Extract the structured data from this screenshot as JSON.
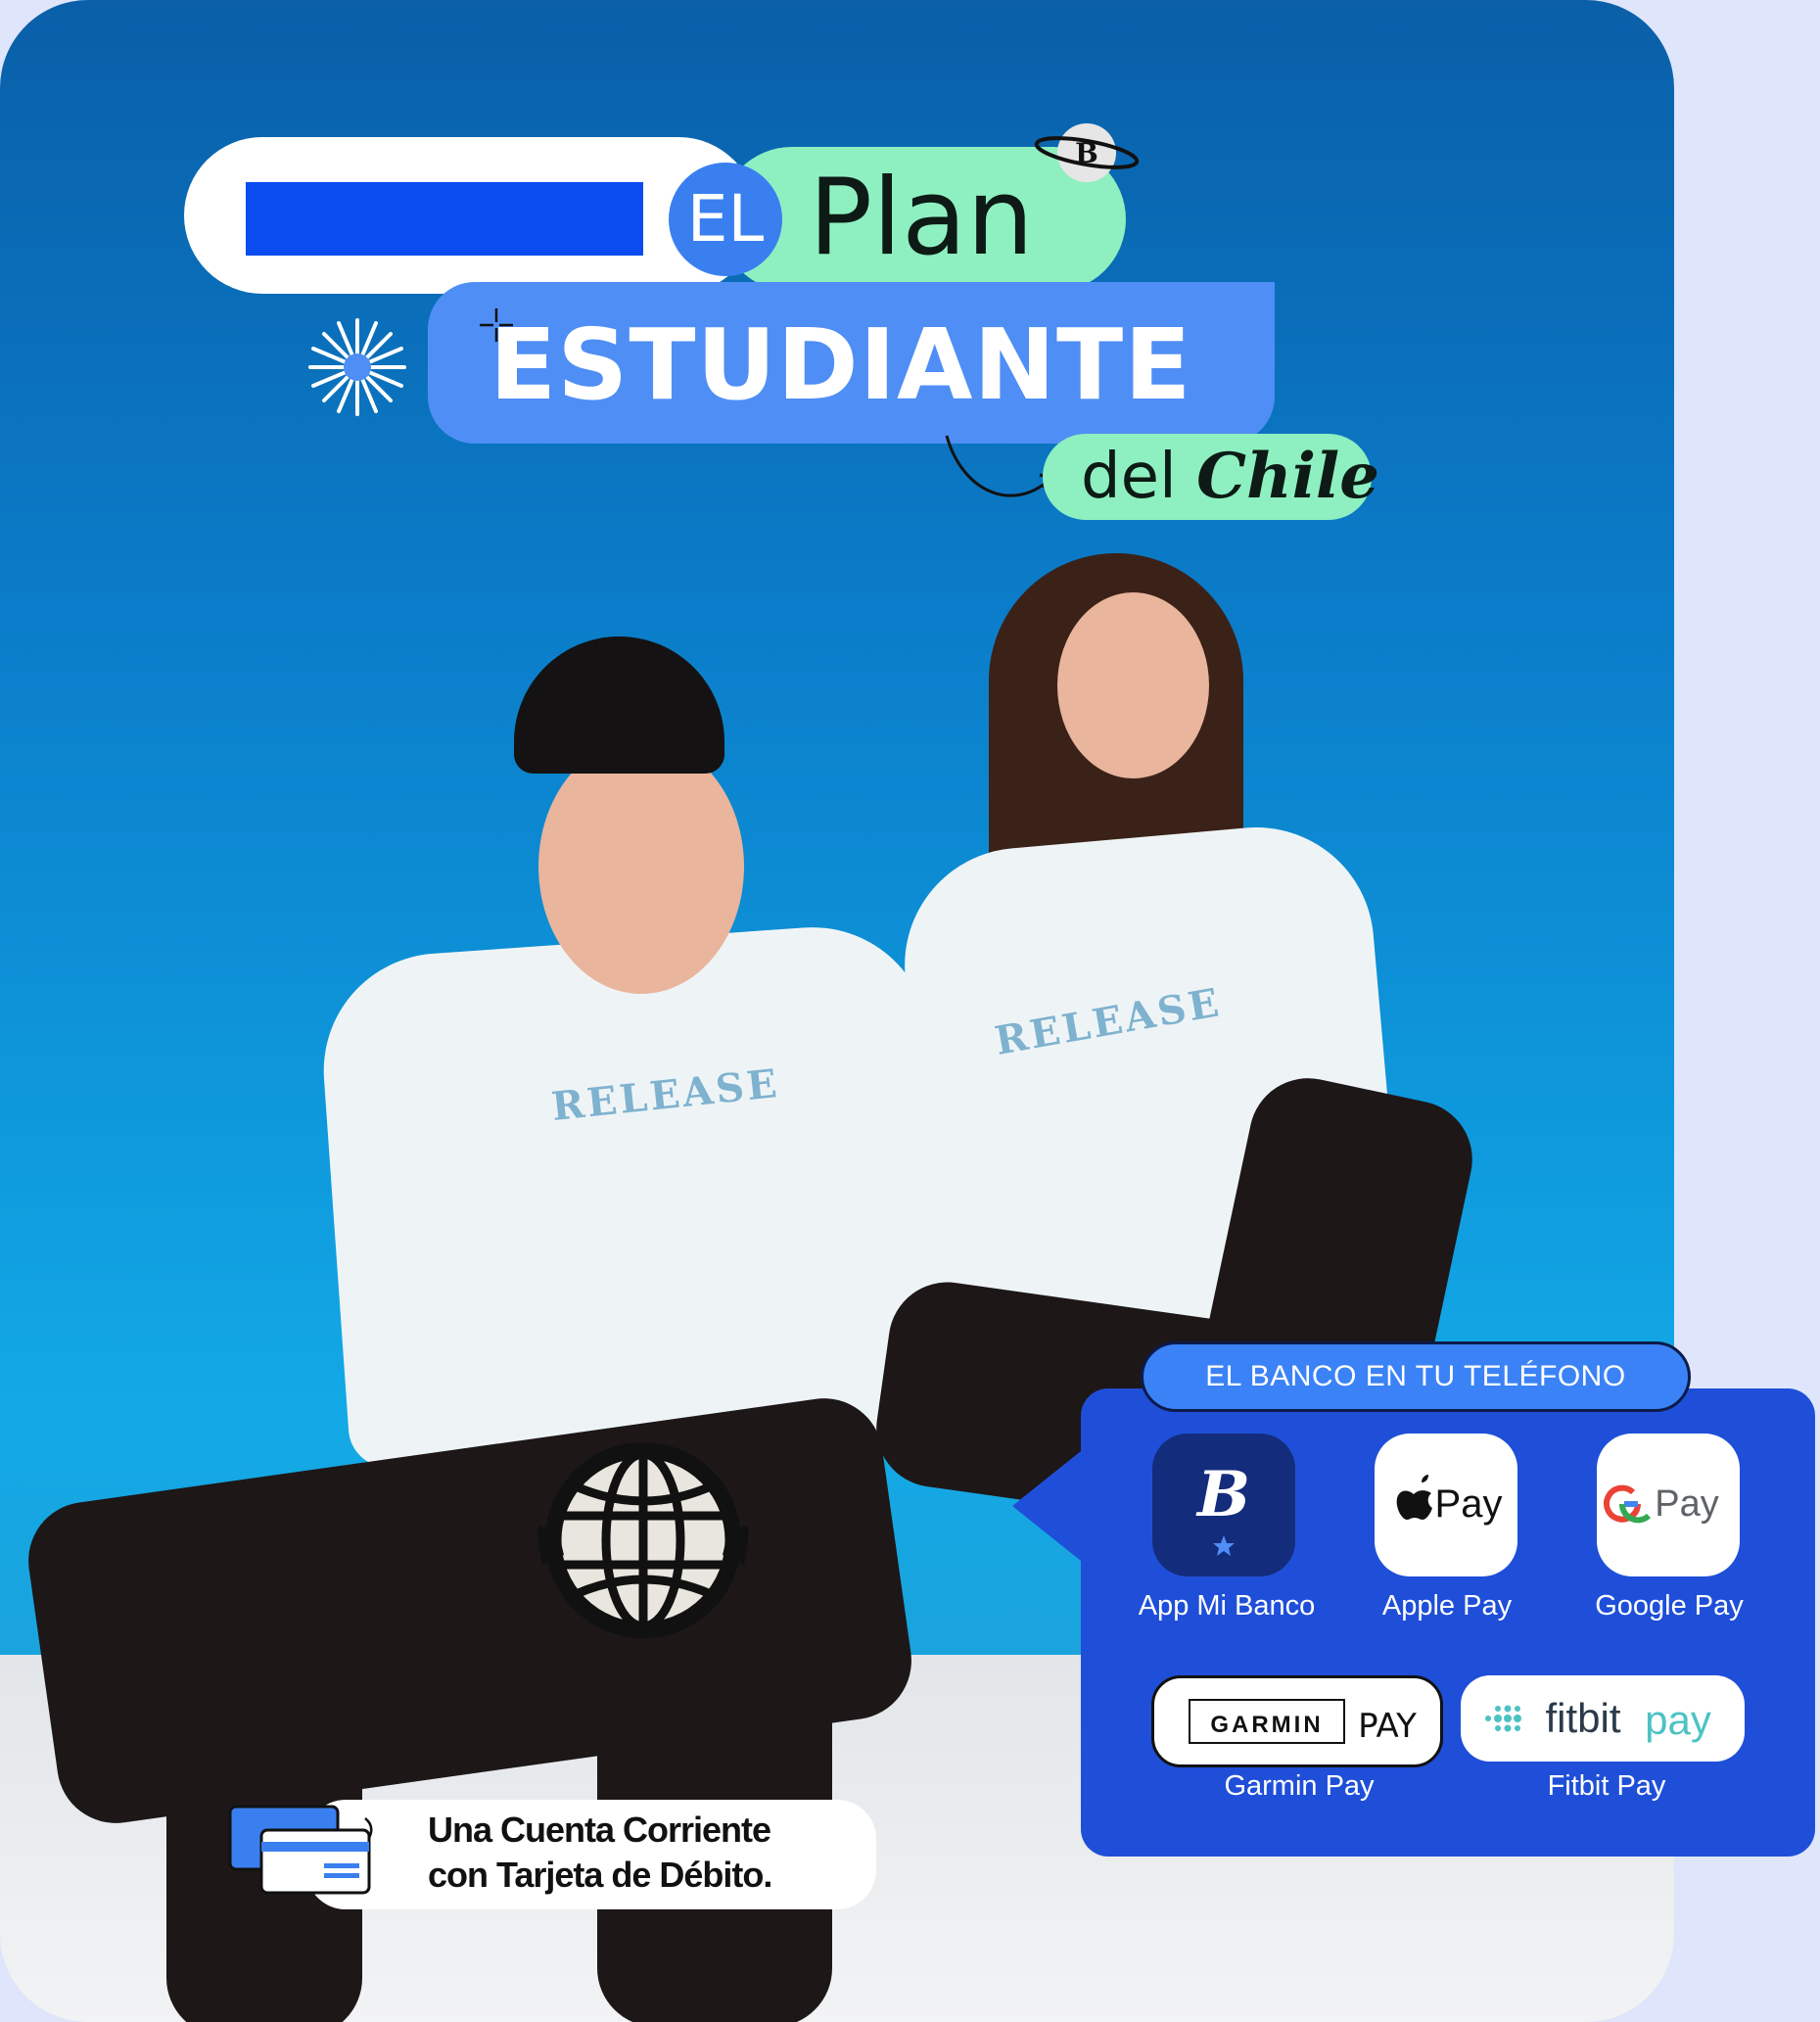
{
  "headline": {
    "el": "EL",
    "plan": "Plan",
    "estudiante": "ESTUDIANTE",
    "del": "del",
    "chile": "Chile"
  },
  "shirt_print": "RELEASE",
  "card_badge": {
    "line1": "Una Cuenta Corriente",
    "line2": "con Tarjeta de Débito."
  },
  "bank_panel": {
    "title": "EL BANCO EN TU TELÉFONO",
    "apps": [
      {
        "label": "App Mi Banco",
        "icon": "mi-banco-icon"
      },
      {
        "label": "Apple Pay",
        "icon": "apple-pay-icon",
        "mark": "Pay"
      },
      {
        "label": "Google Pay",
        "icon": "google-pay-icon",
        "mark": "Pay"
      },
      {
        "label": "Garmin Pay",
        "icon": "garmin-pay-icon",
        "mark_left": "GARMIN",
        "mark_right": "PAY"
      },
      {
        "label": "Fitbit Pay",
        "icon": "fitbit-pay-icon",
        "mark_left": "fitbit",
        "mark_right": "pay"
      }
    ]
  },
  "colors": {
    "accent_blue": "#3a7ff0",
    "mint": "#8ef0c0",
    "panel_blue": "#1f4fd8",
    "redaction": "#0a4cf0"
  }
}
